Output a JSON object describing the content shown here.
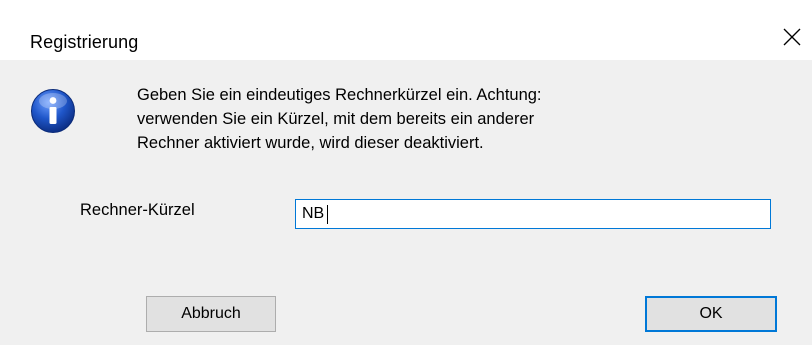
{
  "window": {
    "title": "Registrierung",
    "close_symbol": "×"
  },
  "message": {
    "icon": "info-icon",
    "lines": [
      "Geben Sie ein eindeutiges Rechnerkürzel ein. Achtung:",
      "verwenden Sie ein Kürzel, mit dem bereits ein anderer",
      "Rechner aktiviert wurde, wird dieser deaktiviert."
    ]
  },
  "field": {
    "label": "Rechner-Kürzel",
    "value": "NB"
  },
  "buttons": {
    "cancel_label": "Abbruch",
    "ok_label": "OK"
  },
  "colors": {
    "accent": "#0078d7",
    "dialog_background": "#f0f0f0",
    "button_background": "#e1e1e1",
    "info_icon_blue": "#1a4fb8"
  }
}
